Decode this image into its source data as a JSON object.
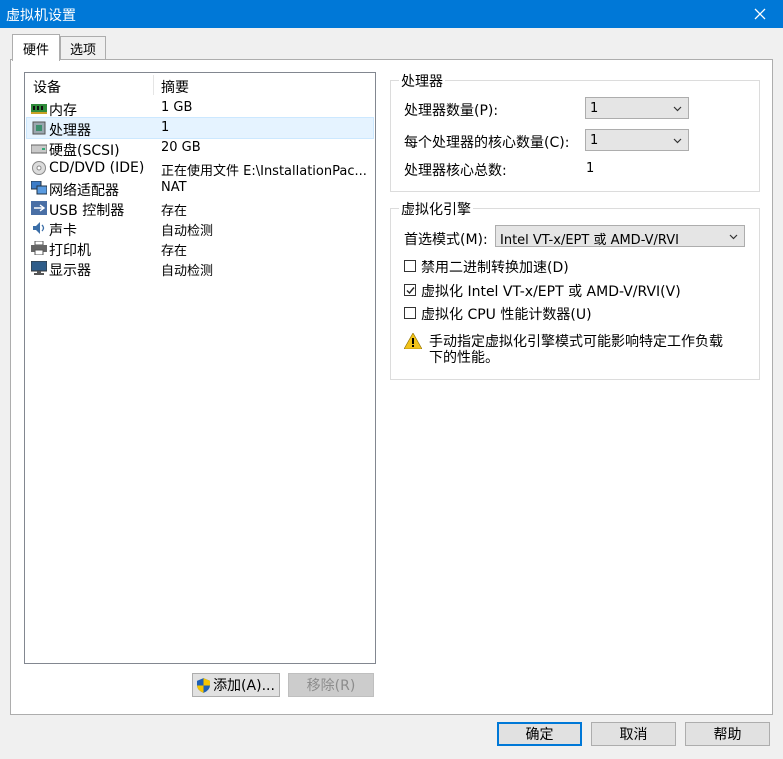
{
  "window": {
    "title": "虚拟机设置"
  },
  "tabs": [
    {
      "label": "硬件"
    },
    {
      "label": "选项"
    }
  ],
  "device_list": {
    "columns": [
      "设备",
      "摘要"
    ],
    "rows": [
      {
        "name": "内存",
        "summary": "1 GB",
        "icon": "memory-icon"
      },
      {
        "name": "处理器",
        "summary": "1",
        "icon": "processor-icon",
        "selected": true
      },
      {
        "name": "硬盘(SCSI)",
        "summary": "20 GB",
        "icon": "harddisk-icon"
      },
      {
        "name": "CD/DVD (IDE)",
        "summary": "正在使用文件 E:\\InstallationPac...",
        "icon": "cd-dvd-icon"
      },
      {
        "name": "网络适配器",
        "summary": "NAT",
        "icon": "network-adapter-icon"
      },
      {
        "name": "USB 控制器",
        "summary": "存在",
        "icon": "usb-icon"
      },
      {
        "name": "声卡",
        "summary": "自动检测",
        "icon": "sound-card-icon"
      },
      {
        "name": "打印机",
        "summary": "存在",
        "icon": "printer-icon"
      },
      {
        "name": "显示器",
        "summary": "自动检测",
        "icon": "display-icon"
      }
    ]
  },
  "list_buttons": {
    "add": "添加(A)...",
    "remove": "移除(R)"
  },
  "processor": {
    "legend": "处理器",
    "count_label": "处理器数量(P):",
    "count_value": "1",
    "cores_label": "每个处理器的核心数量(C):",
    "cores_value": "1",
    "total_label": "处理器核心总数:",
    "total_value": "1"
  },
  "virtualization": {
    "legend": "虚拟化引擎",
    "mode_label": "首选模式(M):",
    "mode_value": "Intel VT-x/EPT 或 AMD-V/RVI",
    "options": [
      {
        "label": "禁用二进制转换加速(D)",
        "checked": false
      },
      {
        "label": "虚拟化 Intel VT-x/EPT 或 AMD-V/RVI(V)",
        "checked": true
      },
      {
        "label": "虚拟化 CPU 性能计数器(U)",
        "checked": false
      }
    ],
    "warning": "手动指定虚拟化引擎模式可能影响特定工作负载下的性能。",
    "warning_line1": "手动指定虚拟化引擎模式可能影响特定工作负载",
    "warning_line2": "下的性能。"
  },
  "dialog_buttons": {
    "ok": "确定",
    "cancel": "取消",
    "help": "帮助"
  },
  "colors": {
    "titlebar": "#0078d7",
    "selection": "#e5f3ff",
    "accent": "#0078d7"
  }
}
